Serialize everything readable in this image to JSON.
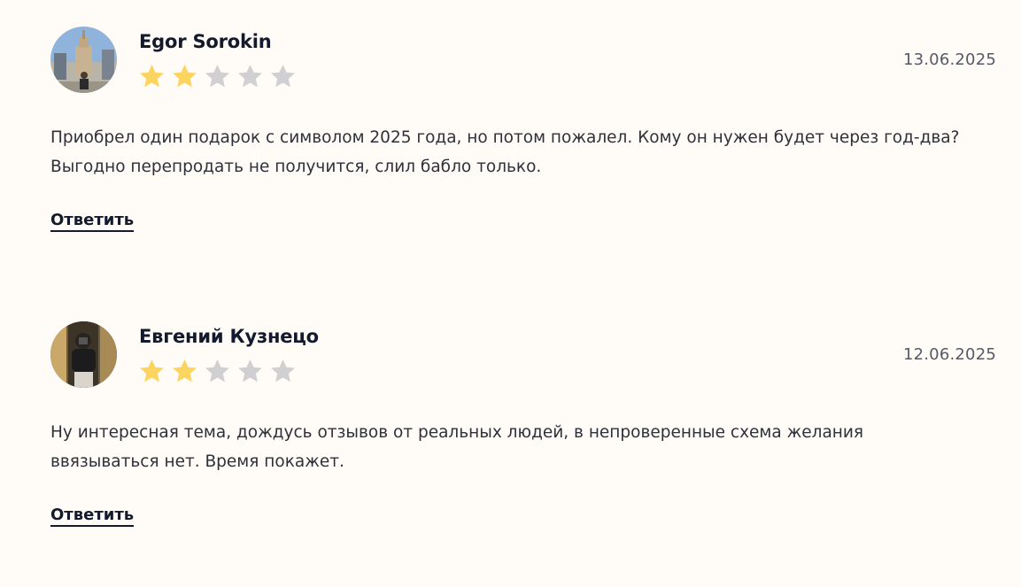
{
  "colors": {
    "star_filled": "#fbd560",
    "star_empty": "#d0cfd1",
    "background": "#fffbf7"
  },
  "reviews": [
    {
      "author": "Egor Sorokin",
      "date": "13.06.2025",
      "rating": 2,
      "max_rating": 5,
      "text": "Приобрел один подарок с символом 2025 года, но потом пожалел. Кому он нужен будет через год-два? Выгодно перепродать не получится, слил бабло только.",
      "reply_label": "Ответить"
    },
    {
      "author": "Евгений Кузнецо",
      "date": "12.06.2025",
      "rating": 2,
      "max_rating": 5,
      "text": "Ну интересная тема, дождусь отзывов от реальных людей, в непроверенные схема желания ввязываться нет. Время покажет.",
      "reply_label": "Ответить"
    }
  ]
}
